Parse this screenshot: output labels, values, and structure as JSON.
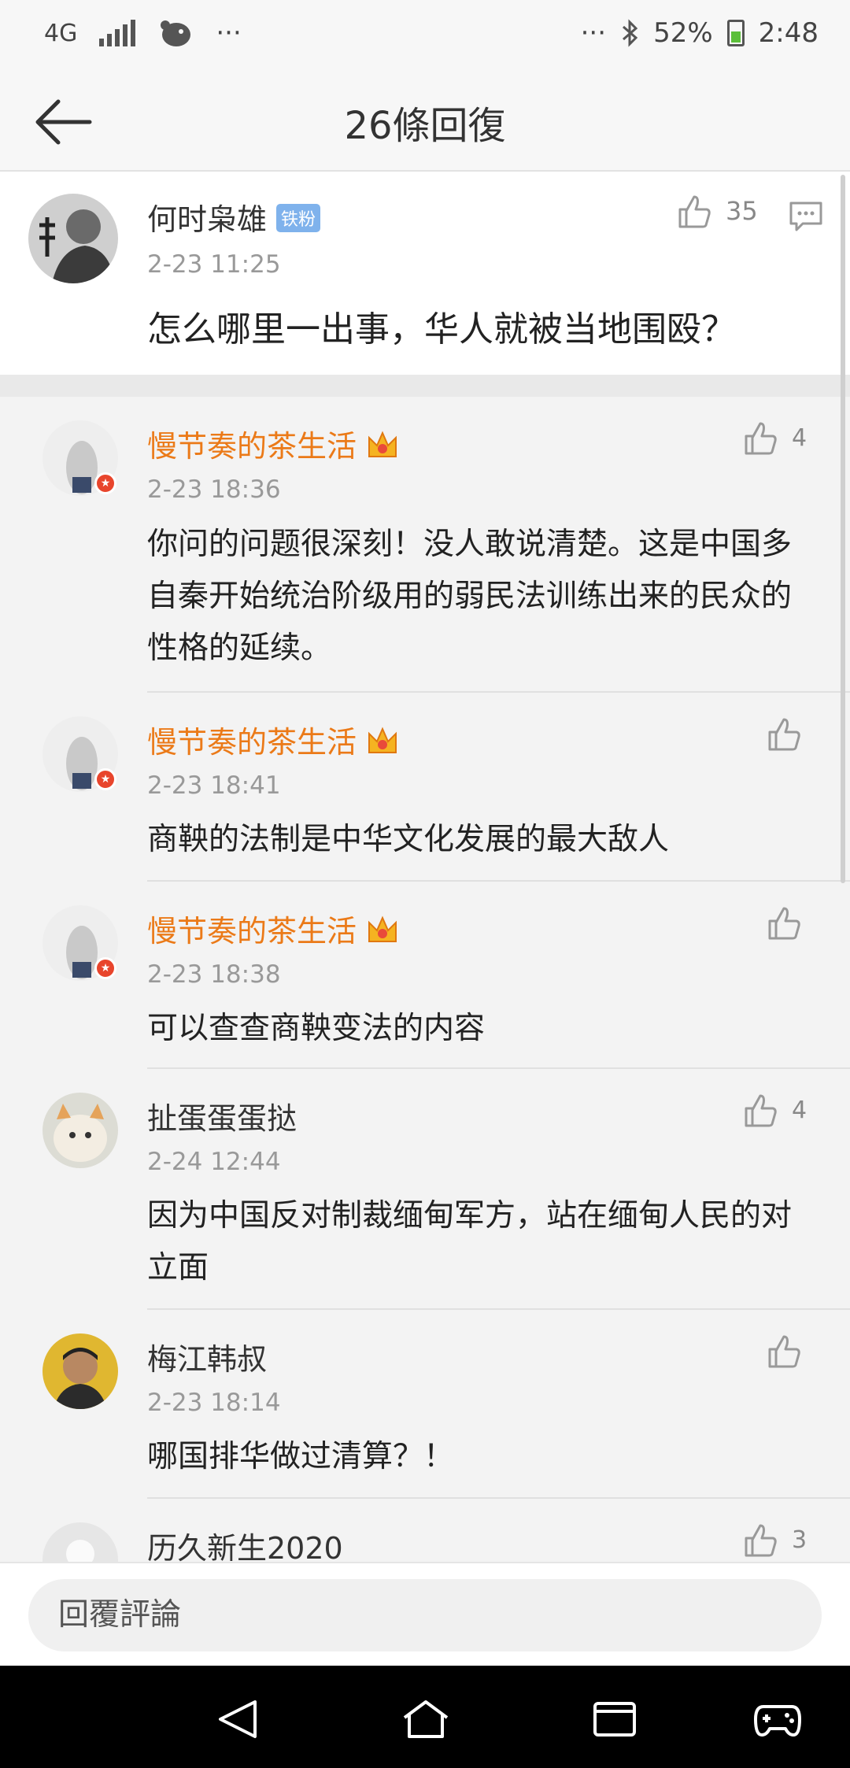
{
  "status_bar": {
    "network": "4G",
    "dots_left": "···",
    "dots_right": "···",
    "battery": "52%",
    "time": "2:48"
  },
  "header": {
    "title": "26條回復"
  },
  "main_post": {
    "author": "何时枭雄",
    "badge": "铁粉",
    "time": "2-23 11:25",
    "likes": "35",
    "text": "怎么哪里一出事，华人就被当地围殴？"
  },
  "replies": [
    {
      "author": "慢节奏的茶生活",
      "vip": true,
      "time": "2-23 18:36",
      "likes": "4",
      "text": "你问的问题很深刻！没人敢说清楚。这是中国多自秦开始统治阶级用的弱民法训练出来的民众的性格的延续。"
    },
    {
      "author": "慢节奏的茶生活",
      "vip": true,
      "time": "2-23 18:41",
      "likes": "",
      "text": "商鞅的法制是中华文化发展的最大敌人"
    },
    {
      "author": "慢节奏的茶生活",
      "vip": true,
      "time": "2-23 18:38",
      "likes": "",
      "text": "可以查查商鞅变法的内容"
    },
    {
      "author": "扯蛋蛋蛋挞",
      "vip": false,
      "time": "2-24 12:44",
      "likes": "4",
      "text": "因为中国反对制裁缅甸军方，站在缅甸人民的对立面"
    },
    {
      "author": "梅江韩叔",
      "vip": false,
      "time": "2-23 18:14",
      "likes": "",
      "text": "哪国排华做过清算？！"
    },
    {
      "author": "历久新生2020",
      "vip": false,
      "time": "",
      "likes": "3",
      "text": ""
    }
  ],
  "reply_bar": {
    "placeholder": "回覆評論"
  },
  "colors": {
    "vip_name": "#eb7a18",
    "iron_badge": "#7fb2ec",
    "verified_badge": "#e8452c"
  }
}
